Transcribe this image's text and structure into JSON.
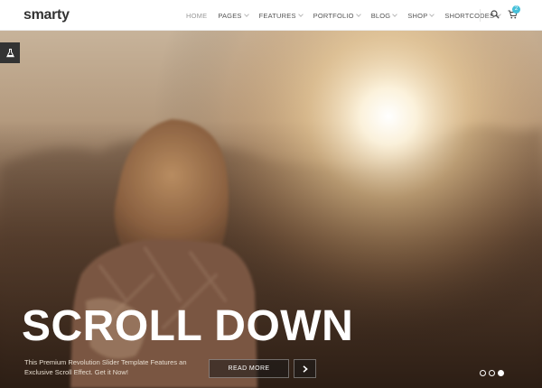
{
  "header": {
    "logo": "smarty",
    "nav": [
      {
        "label": "HOME"
      },
      {
        "label": "PAGES"
      },
      {
        "label": "FEATURES"
      },
      {
        "label": "PORTFOLIO"
      },
      {
        "label": "BLOG"
      },
      {
        "label": "SHOP"
      },
      {
        "label": "SHORTCODES"
      }
    ],
    "cart_count": "2",
    "icons": [
      "search-icon",
      "cart-icon"
    ]
  },
  "side_tab": {
    "icon": "flask-icon"
  },
  "hero": {
    "headline": "SCROLL DOWN",
    "description": "This Premium Revolution Slider Template Features an Exclusive Scroll Effect. Get it Now!",
    "read_more_label": "READ MORE",
    "next_icon": "chevron-right-icon",
    "slides": 3,
    "active_slide": 3
  },
  "colors": {
    "accent": "#45c0d9",
    "header_bg": "#ffffff",
    "tab_bg": "#333333"
  }
}
